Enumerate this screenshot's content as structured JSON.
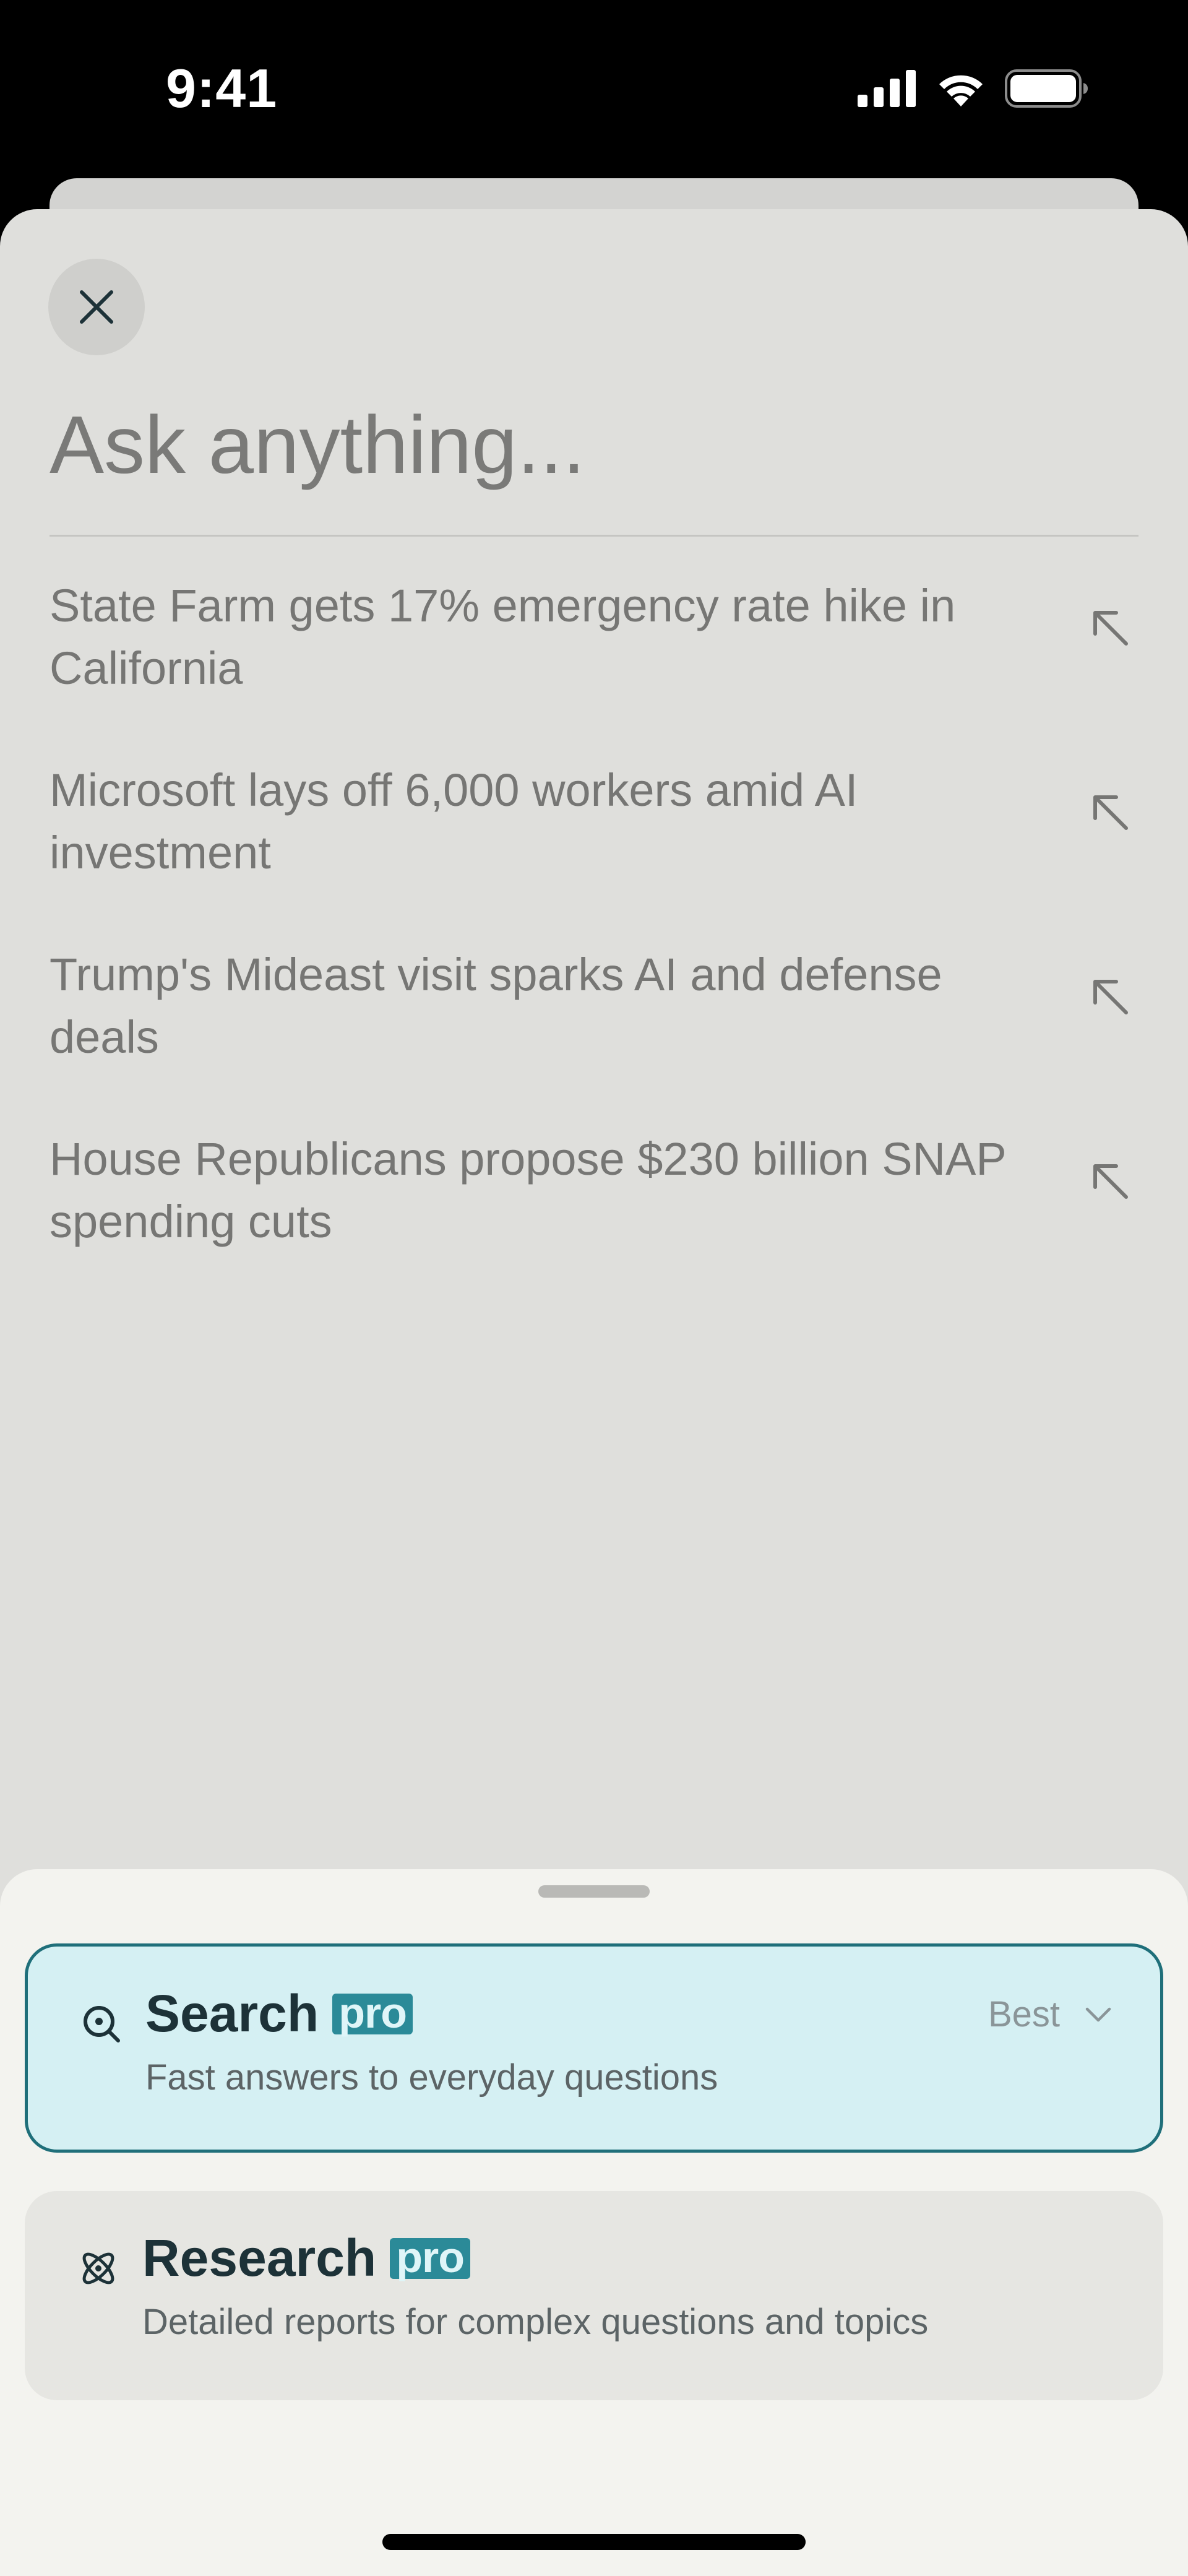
{
  "status_bar": {
    "time": "9:41"
  },
  "composer": {
    "placeholder": "Ask anything..."
  },
  "suggestions": [
    {
      "text": "State Farm gets 17% emergency rate hike in California"
    },
    {
      "text": "Microsoft lays off 6,000 workers amid AI investment"
    },
    {
      "text": "Trump's Mideast visit sparks AI and defense deals"
    },
    {
      "text": "House Republicans propose $230 billion SNAP spending cuts"
    }
  ],
  "modes": [
    {
      "title": "Search",
      "badge": "pro",
      "description": "Fast answers to everyday questions",
      "model": "Best",
      "icon": "search-focus-icon",
      "selected": true
    },
    {
      "title": "Research",
      "badge": "pro",
      "description": "Detailed reports for complex questions and topics",
      "icon": "atom-icon",
      "selected": false
    }
  ],
  "colors": {
    "accent": "#1f6f7a",
    "badge": "#2b8a98",
    "selected_bg": "#d5f0f3",
    "sheet_bg": "#dfdfdc",
    "bottom_bg": "#f3f3ef"
  }
}
